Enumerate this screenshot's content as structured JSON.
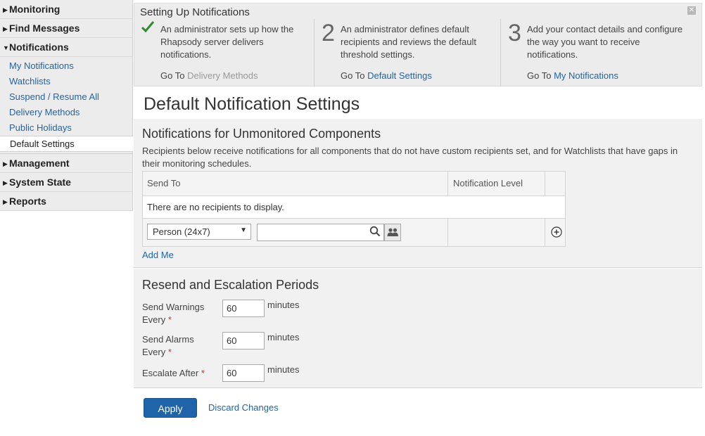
{
  "sidebar": {
    "sections": [
      {
        "label": "Monitoring"
      },
      {
        "label": "Find Messages"
      },
      {
        "label": "Notifications"
      },
      {
        "label": "Management"
      },
      {
        "label": "System State"
      },
      {
        "label": "Reports"
      }
    ],
    "notifications_items": [
      {
        "label": "My Notifications"
      },
      {
        "label": "Watchlists"
      },
      {
        "label": "Suspend / Resume All"
      },
      {
        "label": "Delivery Methods"
      },
      {
        "label": "Public Holidays"
      },
      {
        "label": "Default Settings",
        "active": true
      }
    ]
  },
  "setup": {
    "title": "Setting Up Notifications",
    "close_icon": "close-icon",
    "steps": [
      {
        "mark": "✓",
        "desc": "An administrator sets up how the Rhapsody server delivers notifications.",
        "goto_prefix": "Go To",
        "goto_link": "Delivery Methods"
      },
      {
        "mark": "2",
        "desc": "An administrator defines default recipients and reviews the default threshold settings.",
        "goto_prefix": "Go To",
        "goto_link": "Default Settings"
      },
      {
        "mark": "3",
        "desc": "Add your contact details and configure the way you want to receive notifications.",
        "goto_prefix": "Go To",
        "goto_link": "My Notifications"
      }
    ]
  },
  "page": {
    "title": "Default Notification Settings"
  },
  "unmonitored": {
    "title": "Notifications for Unmonitored Components",
    "description": "Recipients below receive notifications for all components that do not have custom recipients set, and for Watchlists that have gaps in their monitoring schedules.",
    "table": {
      "col_send_to": "Send To",
      "col_level": "Notification Level",
      "empty_text": "There are no recipients to display."
    },
    "recipient_type": "Person (24x7)",
    "search_value": "",
    "add_me": "Add Me"
  },
  "resend": {
    "title": "Resend and Escalation Periods",
    "fields": [
      {
        "label": "Send Warnings Every",
        "value": "60",
        "unit": "minutes"
      },
      {
        "label": "Send Alarms Every",
        "value": "60",
        "unit": "minutes"
      },
      {
        "label": "Escalate After",
        "value": "60",
        "unit": "minutes"
      }
    ],
    "required_mark": "*"
  },
  "footer": {
    "apply": "Apply",
    "discard": "Discard Changes"
  },
  "colors": {
    "link": "#1f64a8",
    "primary_button": "#1f64a8",
    "check": "#2e8b2e",
    "required": "#c0392b"
  }
}
